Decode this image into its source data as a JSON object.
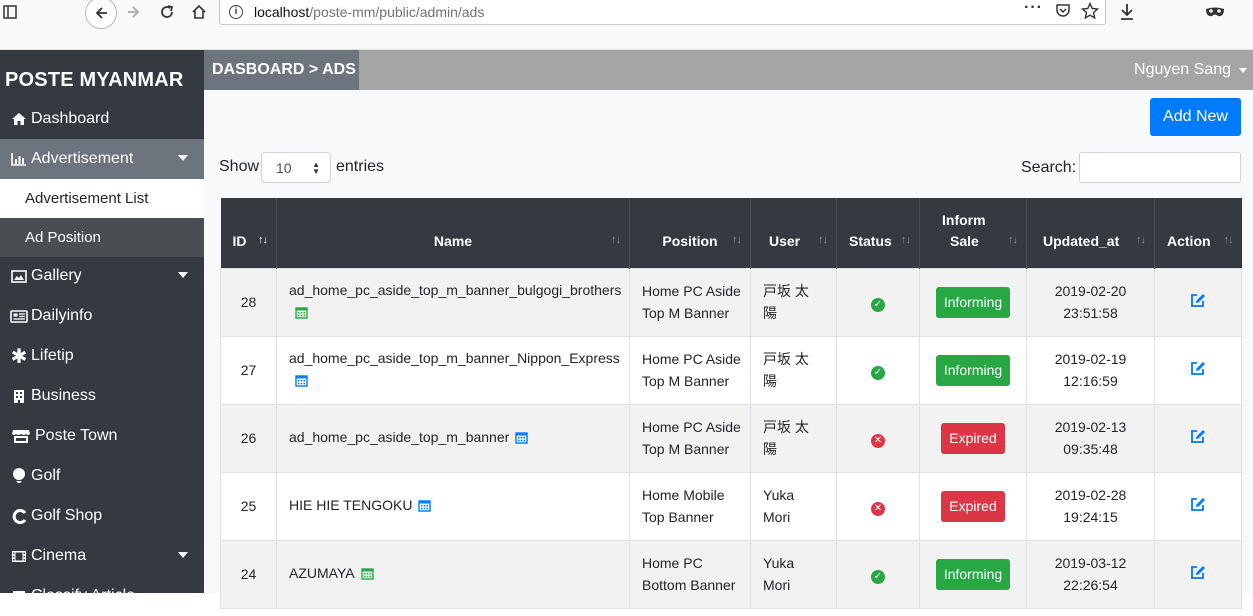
{
  "browser": {
    "url_host": "localhost",
    "url_path": "/poste-mm/public/admin/ads"
  },
  "sidebar": {
    "brand": "POSTE MYANMAR",
    "items": [
      {
        "label": "Dashboard",
        "icon": "home-icon"
      },
      {
        "label": "Advertisement",
        "icon": "bar-chart-icon"
      },
      {
        "label": "Gallery",
        "icon": "image-icon"
      },
      {
        "label": "Dailyinfo",
        "icon": "newspaper-icon"
      },
      {
        "label": "Lifetip",
        "icon": "asterisk-icon"
      },
      {
        "label": "Business",
        "icon": "building-icon"
      },
      {
        "label": "Poste Town",
        "icon": "store-icon"
      },
      {
        "label": "Golf",
        "icon": "golf-ball-icon"
      },
      {
        "label": "Golf Shop",
        "icon": "golf-shop-icon"
      },
      {
        "label": "Cinema",
        "icon": "film-icon"
      },
      {
        "label": "Classify Article",
        "icon": "list-icon"
      }
    ],
    "sub_items": [
      {
        "label": "Advertisement List"
      },
      {
        "label": "Ad Position"
      }
    ]
  },
  "topbar": {
    "breadcrumb": "DASBOARD > ADS",
    "user": "Nguyen Sang"
  },
  "main": {
    "add_new": "Add New",
    "show_label": "Show",
    "entries_value": "10",
    "entries_label": "entries",
    "search_label": "Search:",
    "search_value": ""
  },
  "table": {
    "headers": {
      "id": "ID",
      "name": "Name",
      "position": "Position",
      "user": "User",
      "status": "Status",
      "inform_sale_1": "Inform",
      "inform_sale_2": "Sale",
      "updated_at": "Updated_at",
      "action": "Action"
    },
    "rows": [
      {
        "id": "28",
        "name_1": "ad_home_pc_aside_top_m_banner_bulgogi_brothers",
        "cal_color": "#28a745",
        "pos_1": "Home PC Aside",
        "pos_2": "Top M Banner",
        "user_1": "戸坂 太",
        "user_2": "陽",
        "status": "active",
        "inform": "Informing",
        "inform_state": "informing",
        "date": "2019-02-20",
        "time": "23:51:58"
      },
      {
        "id": "27",
        "name_1": "ad_home_pc_aside_top_m_banner_Nippon_Express",
        "cal_color": "#007bff",
        "pos_1": "Home PC Aside",
        "pos_2": "Top M Banner",
        "user_1": "戸坂 太",
        "user_2": "陽",
        "status": "active",
        "inform": "Informing",
        "inform_state": "informing",
        "date": "2019-02-19",
        "time": "12:16:59"
      },
      {
        "id": "26",
        "name_1": "ad_home_pc_aside_top_m_banner",
        "cal_color": "#007bff",
        "pos_1": "Home PC Aside",
        "pos_2": "Top M Banner",
        "user_1": "戸坂 太",
        "user_2": "陽",
        "status": "inactive",
        "inform": "Expired",
        "inform_state": "expired",
        "date": "2019-02-13",
        "time": "09:35:48"
      },
      {
        "id": "25",
        "name_1": "HIE HIE TENGOKU",
        "cal_color": "#007bff",
        "pos_1": "Home Mobile",
        "pos_2": "Top Banner",
        "user_1": "Yuka",
        "user_2": "Mori",
        "status": "inactive",
        "inform": "Expired",
        "inform_state": "expired",
        "date": "2019-02-28",
        "time": "19:24:15"
      },
      {
        "id": "24",
        "name_1": "AZUMAYA",
        "cal_color": "#28a745",
        "pos_1": "Home PC",
        "pos_2": "Bottom Banner",
        "user_1": "Yuka",
        "user_2": "Mori",
        "status": "active",
        "inform": "Informing",
        "inform_state": "informing",
        "date": "2019-03-12",
        "time": "22:26:54"
      }
    ]
  },
  "colors": {
    "sidebar_bg": "#343a40",
    "active_nav_bg": "#6c757d",
    "primary": "#007bff",
    "success": "#28a745",
    "danger": "#dc3545"
  }
}
